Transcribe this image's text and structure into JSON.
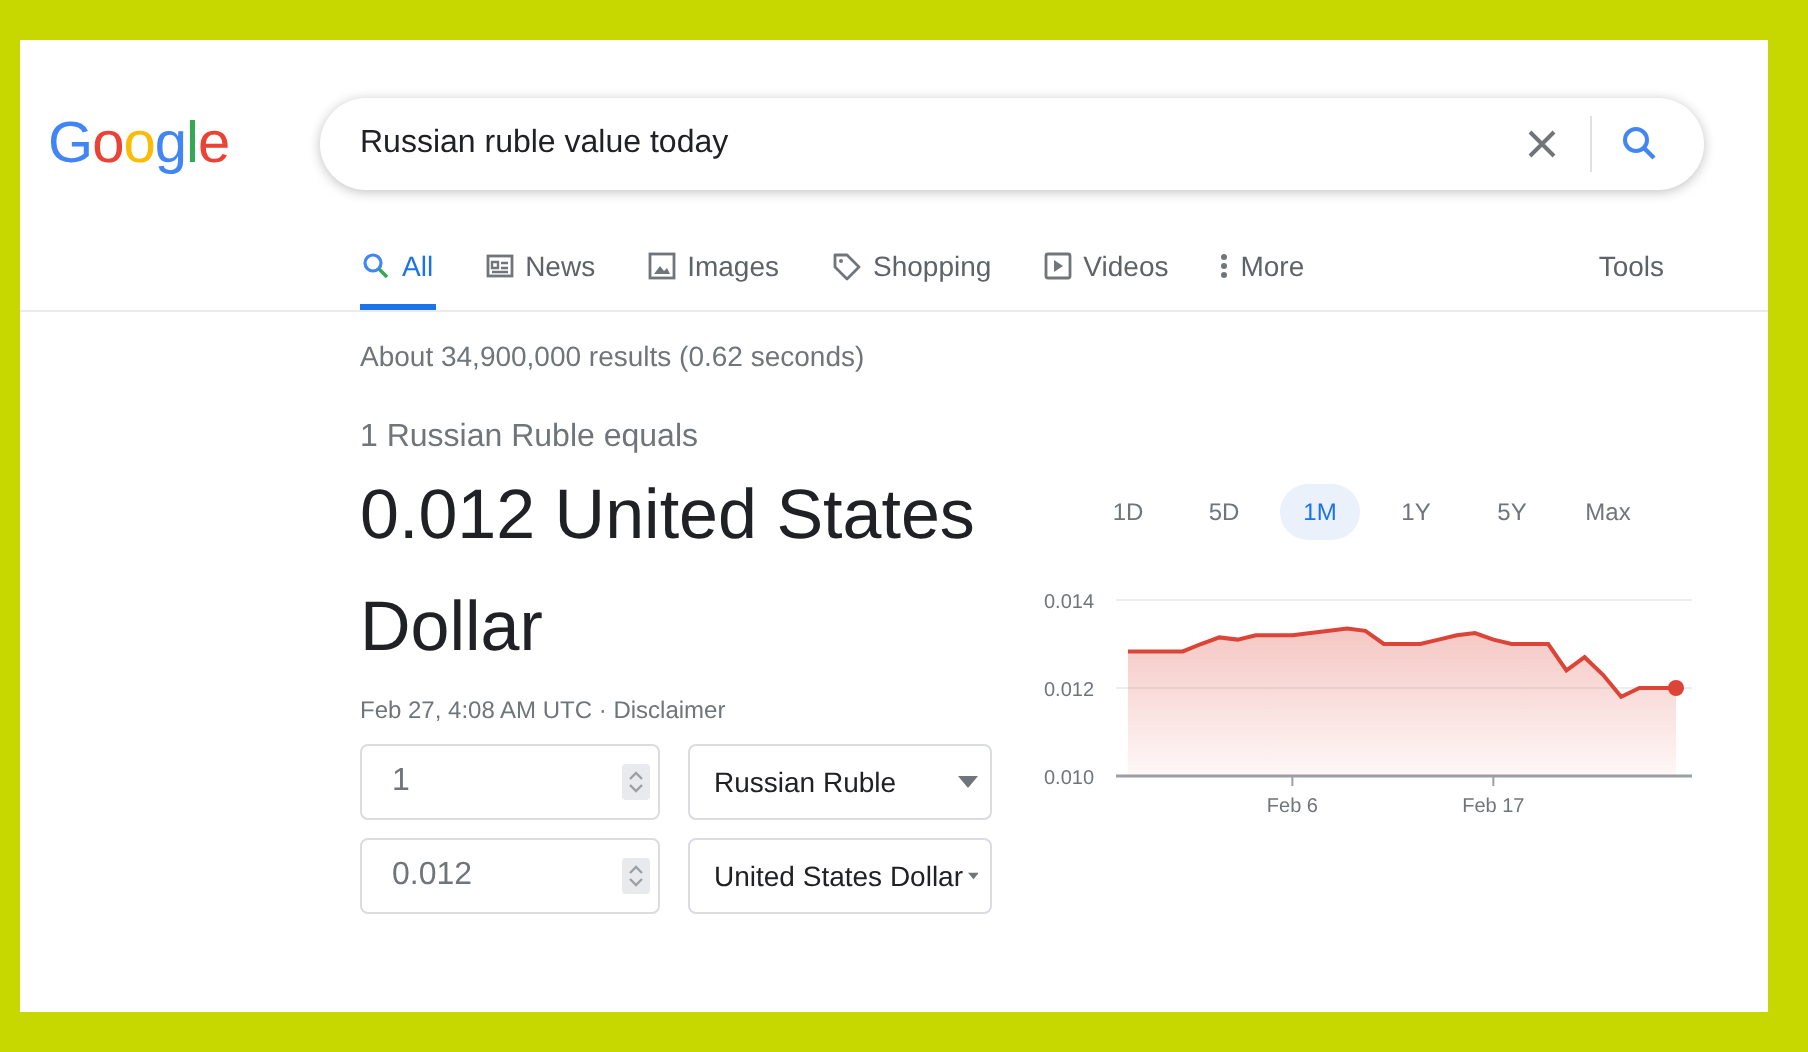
{
  "logo": {
    "letters": [
      {
        "char": "G",
        "color": "#4285f4"
      },
      {
        "char": "o",
        "color": "#ea4335"
      },
      {
        "char": "o",
        "color": "#fbbc05"
      },
      {
        "char": "g",
        "color": "#4285f4"
      },
      {
        "char": "l",
        "color": "#34a853"
      },
      {
        "char": "e",
        "color": "#ea4335"
      }
    ]
  },
  "search": {
    "value": "Russian ruble value today"
  },
  "tabs": [
    {
      "label": "All",
      "kind": "all",
      "selected": true
    },
    {
      "label": "News",
      "kind": "news",
      "selected": false
    },
    {
      "label": "Images",
      "kind": "images",
      "selected": false
    },
    {
      "label": "Shopping",
      "kind": "shopping",
      "selected": false
    },
    {
      "label": "Videos",
      "kind": "videos",
      "selected": false
    },
    {
      "label": "More",
      "kind": "more",
      "selected": false
    }
  ],
  "tools": "Tools",
  "result_stats": "About 34,900,000 results (0.62 seconds)",
  "converter": {
    "intro": "1 Russian Ruble equals",
    "result": "0.012 United States Dollar",
    "timestamp": "Feb 27, 4:08 AM UTC · ",
    "disclaimer": "Disclaimer",
    "rows": [
      {
        "amount": "1",
        "currency": "Russian Ruble"
      },
      {
        "amount": "0.012",
        "currency": "United States Dollar"
      }
    ]
  },
  "periods": [
    {
      "label": "1D",
      "selected": false
    },
    {
      "label": "5D",
      "selected": false
    },
    {
      "label": "1M",
      "selected": true
    },
    {
      "label": "1Y",
      "selected": false
    },
    {
      "label": "5Y",
      "selected": false
    },
    {
      "label": "Max",
      "selected": false
    }
  ],
  "chart_data": {
    "type": "area",
    "categories": [
      null,
      null,
      null,
      null,
      null,
      null,
      null,
      null,
      null,
      "Feb 6",
      null,
      null,
      null,
      null,
      null,
      null,
      null,
      null,
      null,
      null,
      "Feb 17",
      null,
      null,
      null,
      null,
      null,
      null,
      null,
      null,
      null,
      null
    ],
    "series": [
      {
        "color": "#db4437",
        "values": [
          0.01283,
          0.01283,
          0.01283,
          0.01283,
          0.013,
          0.01315,
          0.0131,
          0.0132,
          0.0132,
          0.0132,
          0.01325,
          0.0133,
          0.01335,
          0.0133,
          0.013,
          0.013,
          0.013,
          0.0131,
          0.0132,
          0.01325,
          0.0131,
          0.013,
          0.013,
          0.013,
          0.0124,
          0.0127,
          0.0123,
          0.0118,
          0.012,
          0.012,
          0.012
        ]
      }
    ],
    "ylim": [
      0.01,
      0.014
    ],
    "yticks": [
      {
        "value": 0.01,
        "label": "0.010"
      },
      {
        "value": 0.012,
        "label": "0.012"
      },
      {
        "value": 0.014,
        "label": "0.014"
      }
    ]
  }
}
